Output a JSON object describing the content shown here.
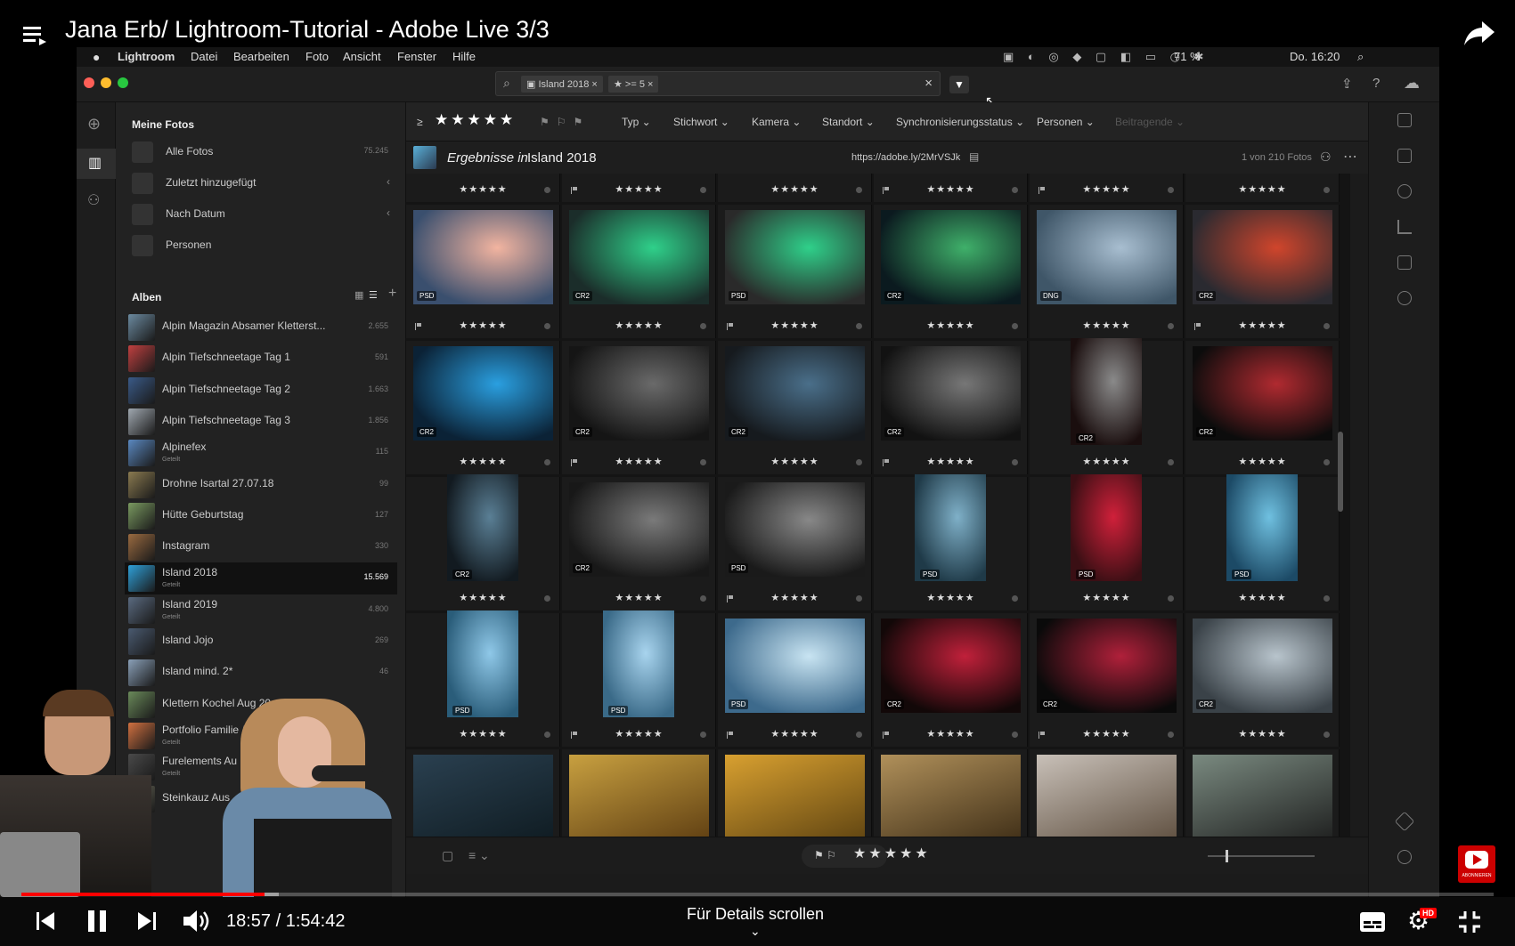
{
  "video": {
    "title": "Jana Erb/ Lightroom-Tutorial - Adobe Live 3/3",
    "time_current": "18:57",
    "time_total": "1:54:42",
    "time_display": "18:57 / 1:54:42",
    "details_hint": "Für Details scrollen",
    "progress_fraction": 0.165,
    "subscribe_label": "ABONNIEREN",
    "hd_badge": "HD"
  },
  "macos_menubar": {
    "app": "Lightroom",
    "menus": [
      "Datei",
      "Bearbeiten",
      "Foto",
      "Ansicht",
      "Fenster",
      "Hilfe"
    ],
    "battery": "71 %",
    "clock": "Do. 16:20"
  },
  "search": {
    "chips": [
      "Island 2018",
      "★ >= 5"
    ]
  },
  "sidebar": {
    "my_photos_title": "Meine Fotos",
    "items": [
      {
        "label": "Alle Fotos",
        "count": "75.245",
        "icon": "photos-icon"
      },
      {
        "label": "Zuletzt hinzugefügt",
        "count": "",
        "icon": "clock-icon"
      },
      {
        "label": "Nach Datum",
        "count": "",
        "icon": "calendar-icon"
      },
      {
        "label": "Personen",
        "count": "",
        "icon": "person-icon"
      }
    ],
    "albums_title": "Alben",
    "albums": [
      {
        "label": "Alpin Magazin Absamer Kletterst...",
        "sub": "",
        "count": "2.655"
      },
      {
        "label": "Alpin Tiefschneetage Tag 1",
        "sub": "",
        "count": "591"
      },
      {
        "label": "Alpin Tiefschneetage Tag 2",
        "sub": "",
        "count": "1.663"
      },
      {
        "label": "Alpin Tiefschneetage Tag 3",
        "sub": "",
        "count": "1.856"
      },
      {
        "label": "Alpinefex",
        "sub": "Geteilt",
        "count": "115"
      },
      {
        "label": "Drohne Isartal 27.07.18",
        "sub": "",
        "count": "99"
      },
      {
        "label": "Hütte Geburtstag",
        "sub": "",
        "count": "127"
      },
      {
        "label": "Instagram",
        "sub": "",
        "count": "330"
      },
      {
        "label": "Island 2018",
        "sub": "Geteilt",
        "count": "15.569"
      },
      {
        "label": "Island 2019",
        "sub": "Geteilt",
        "count": "4.800"
      },
      {
        "label": "Island Jojo",
        "sub": "",
        "count": "269"
      },
      {
        "label": "Island mind. 2*",
        "sub": "",
        "count": "46"
      },
      {
        "label": "Klettern Kochel Aug 20",
        "sub": "",
        "count": ""
      },
      {
        "label": "Portfolio Familie /",
        "sub": "Geteilt",
        "count": ""
      },
      {
        "label": "Furelements Au",
        "sub": "Geteilt",
        "count": ""
      },
      {
        "label": "Steinkauz Aus",
        "sub": "",
        "count": ""
      }
    ]
  },
  "filterbar": {
    "rating_op": "≥",
    "rating": "★★★★★",
    "filters": [
      "Typ",
      "Stichwort",
      "Kamera",
      "Standort",
      "Synchronisierungsstatus",
      "Personen",
      "Beitragende"
    ]
  },
  "results": {
    "prefix": "Ergebnisse in",
    "album": "Island 2018",
    "link": "https://adobe.ly/2MrVSJk",
    "count": "1 von 210 Fotos"
  },
  "grid": {
    "stars": "★★★★★",
    "rows": [
      [
        {
          "badge": "PSD",
          "c1": "#f2b4a0",
          "c2": "#3a4f6e",
          "portrait": false,
          "flag": true
        },
        {
          "badge": "CR2",
          "c1": "#2fd08a",
          "c2": "#1b2d2a",
          "portrait": false,
          "flag": false
        },
        {
          "badge": "PSD",
          "c1": "#2fd08a",
          "c2": "#2a2a2a",
          "portrait": false,
          "flag": true
        },
        {
          "badge": "CR2",
          "c1": "#3fb06a",
          "c2": "#0b1a1f",
          "portrait": false,
          "flag": false
        },
        {
          "badge": "DNG",
          "c1": "#a8bed0",
          "c2": "#3f5668",
          "portrait": false,
          "flag": false
        },
        {
          "badge": "CR2",
          "c1": "#d0452c",
          "c2": "#2a2a30",
          "portrait": false,
          "flag": true
        }
      ],
      [
        {
          "badge": "CR2",
          "c1": "#2a9fe0",
          "c2": "#0b2236",
          "portrait": false,
          "flag": false
        },
        {
          "badge": "CR2",
          "c1": "#6a6a6a",
          "c2": "#151515",
          "portrait": false,
          "flag": true
        },
        {
          "badge": "CR2",
          "c1": "#4a6f8a",
          "c2": "#161a1e",
          "portrait": false,
          "flag": false
        },
        {
          "badge": "CR2",
          "c1": "#777777",
          "c2": "#121212",
          "portrait": false,
          "flag": true
        },
        {
          "badge": "CR2",
          "c1": "#8a8a8a",
          "c2": "#1a0e0e",
          "portrait": true,
          "flag": false
        },
        {
          "badge": "CR2",
          "c1": "#b02a30",
          "c2": "#0c0c0c",
          "portrait": false,
          "flag": false
        }
      ],
      [
        {
          "badge": "CR2",
          "c1": "#5a7f95",
          "c2": "#121a20",
          "portrait": true,
          "flag": false
        },
        {
          "badge": "CR2",
          "c1": "#7a7a7a",
          "c2": "#181818",
          "portrait": false,
          "flag": false
        },
        {
          "badge": "PSD",
          "c1": "#888888",
          "c2": "#1a1a1a",
          "portrait": false,
          "flag": true
        },
        {
          "badge": "PSD",
          "c1": "#7fb0c8",
          "c2": "#1f3a48",
          "portrait": true,
          "flag": false
        },
        {
          "badge": "PSD",
          "c1": "#d0203a",
          "c2": "#3a0f14",
          "portrait": true,
          "flag": false
        },
        {
          "badge": "PSD",
          "c1": "#6fc0e0",
          "c2": "#1c4a66",
          "portrait": true,
          "flag": false
        }
      ],
      [
        {
          "badge": "PSD",
          "c1": "#8fc8e8",
          "c2": "#2a5d7a",
          "portrait": true,
          "flag": false
        },
        {
          "badge": "PSD",
          "c1": "#a8d4ee",
          "c2": "#3a6a88",
          "portrait": true,
          "flag": true
        },
        {
          "badge": "PSD",
          "c1": "#c8e4f2",
          "c2": "#3d6a8c",
          "portrait": false,
          "flag": true
        },
        {
          "badge": "CR2",
          "c1": "#c0203a",
          "c2": "#120808",
          "portrait": false,
          "flag": true
        },
        {
          "badge": "CR2",
          "c1": "#b0203a",
          "c2": "#0a0a0a",
          "portrait": false,
          "flag": true
        },
        {
          "badge": "CR2",
          "c1": "#b8c4cc",
          "c2": "#3a4248",
          "portrait": false,
          "flag": false
        }
      ]
    ],
    "partial_row_colors": [
      [
        "#2a4050",
        "#0e1a20"
      ],
      [
        "#c8a040",
        "#5a3a10"
      ],
      [
        "#d8a030",
        "#5a4010"
      ],
      [
        "#b0905a",
        "#3a2a14"
      ],
      [
        "#c8c0b8",
        "#5a4a3a"
      ],
      [
        "#7a8a80",
        "#1a1a1a"
      ]
    ]
  },
  "bottombar": {
    "rating": "★★★★★"
  }
}
